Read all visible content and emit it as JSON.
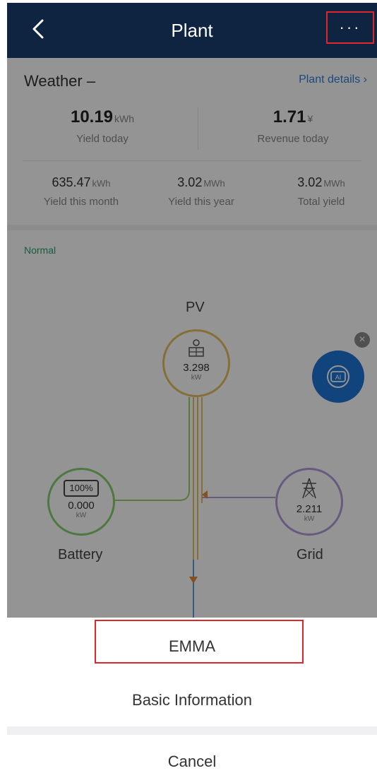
{
  "header": {
    "title": "Plant",
    "more_label": "···"
  },
  "summary": {
    "weather_label": "Weather  –",
    "details_link": "Plant details ›",
    "yield_today": {
      "value": "10.19",
      "unit": "kWh",
      "label": "Yield today"
    },
    "revenue_today": {
      "value": "1.71",
      "unit": "¥",
      "label": "Revenue today"
    },
    "yield_month": {
      "value": "635.47",
      "unit": "kWh",
      "label": "Yield this month"
    },
    "yield_year": {
      "value": "3.02",
      "unit": "MWh",
      "label": "Yield this year"
    },
    "total_yield": {
      "value": "3.02",
      "unit": "MWh",
      "label": "Total yield"
    }
  },
  "status": "Normal",
  "flow": {
    "pv": {
      "label": "PV",
      "value": "3.298",
      "unit": "kW"
    },
    "battery": {
      "label": "Battery",
      "soc": "100%",
      "value": "0.000",
      "unit": "kW"
    },
    "grid": {
      "label": "Grid",
      "value": "2.211",
      "unit": "kW"
    },
    "ai_badge": "AI"
  },
  "sheet": {
    "emma": "EMMA",
    "basic_info": "Basic Information",
    "cancel": "Cancel"
  },
  "colors": {
    "header_bg": "#0f2440",
    "highlight": "#e0262b",
    "link": "#2f7fd6",
    "status_ok": "#2aa36a"
  }
}
